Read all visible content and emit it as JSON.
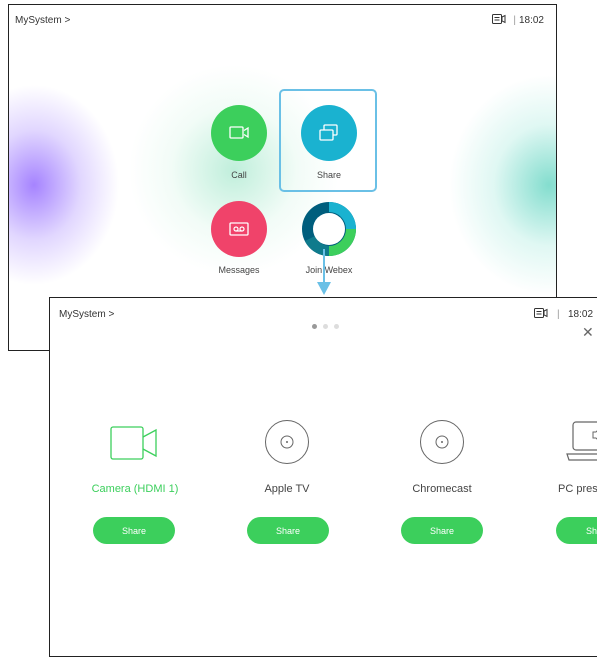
{
  "home": {
    "title": "MySystem >",
    "time": "18:02",
    "separator": "|",
    "status_icon": "camera-status-icon",
    "tiles": [
      {
        "label": "Call",
        "color": "#3ccf5c",
        "icon": "video-icon"
      },
      {
        "label": "Share",
        "color": "#1ab2d0",
        "icon": "share-screens-icon"
      },
      {
        "label": "Messages",
        "color": "#f0436a",
        "icon": "voicemail-icon"
      },
      {
        "label": "Join Webex",
        "icon": "webex-logo-icon"
      }
    ]
  },
  "share_screen": {
    "title": "MySystem >",
    "time": "18:02",
    "separator": "|",
    "pager": {
      "current": 1,
      "total": 3
    },
    "close_icon": "close-icon",
    "sources": [
      {
        "label": "Camera (HDMI 1)",
        "button": "Share",
        "icon": "camera-icon",
        "active": true
      },
      {
        "label": "Apple TV",
        "button": "Share",
        "icon": "disc-icon",
        "active": false
      },
      {
        "label": "Chromecast",
        "button": "Share",
        "icon": "disc-icon",
        "active": false
      },
      {
        "label": "PC pres",
        "button": "Sh",
        "icon": "laptop-icon",
        "active": false
      }
    ],
    "accent": "#3ccf5c"
  },
  "annotation_color": "#6ac0e6"
}
